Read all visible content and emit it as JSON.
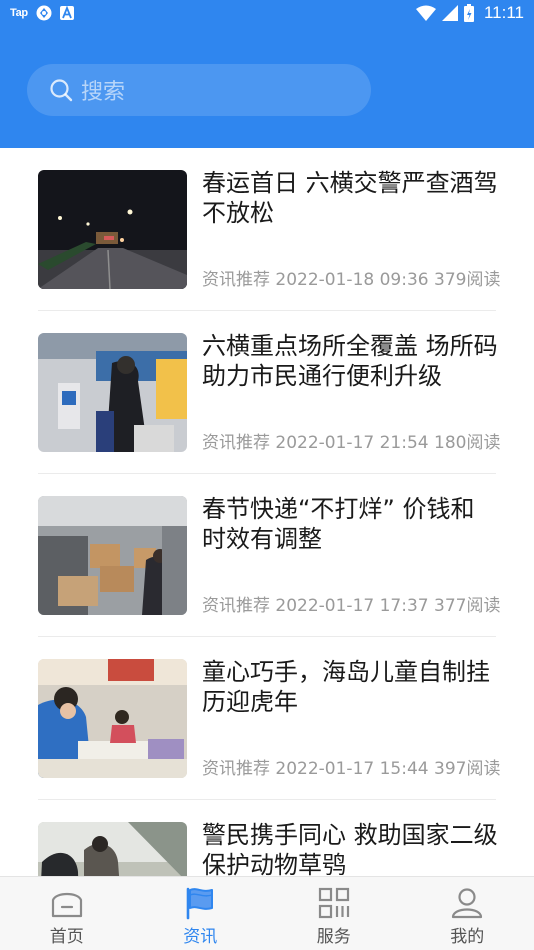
{
  "status_bar": {
    "app_badge": "Tap",
    "time": "11:11"
  },
  "search": {
    "placeholder": "搜索"
  },
  "news": [
    {
      "title": "春运首日 六横交警严查酒驾不放松",
      "meta": "资讯推荐 2022-01-18 09:36 379阅读"
    },
    {
      "title": "六横重点场所全覆盖 场所码助力市民通行便利升级",
      "meta": "资讯推荐 2022-01-17 21:54 180阅读"
    },
    {
      "title": "春节快递“不打烊” 价钱和时效有调整",
      "meta": "资讯推荐 2022-01-17 17:37 377阅读"
    },
    {
      "title": "童心巧手，海岛儿童自制挂历迎虎年",
      "meta": "资讯推荐 2022-01-17 15:44 397阅读"
    },
    {
      "title": "警民携手同心 救助国家二级保护动物草鸮",
      "meta": ""
    }
  ],
  "tabs": [
    {
      "label": "首页",
      "icon": "home-icon",
      "active": false
    },
    {
      "label": "资讯",
      "icon": "flag-icon",
      "active": true
    },
    {
      "label": "服务",
      "icon": "grid-icon",
      "active": false
    },
    {
      "label": "我的",
      "icon": "user-icon",
      "active": false
    }
  ],
  "colors": {
    "primary": "#2f86ef",
    "tab_inactive": "#555555",
    "meta_text": "#9a9a9a"
  }
}
